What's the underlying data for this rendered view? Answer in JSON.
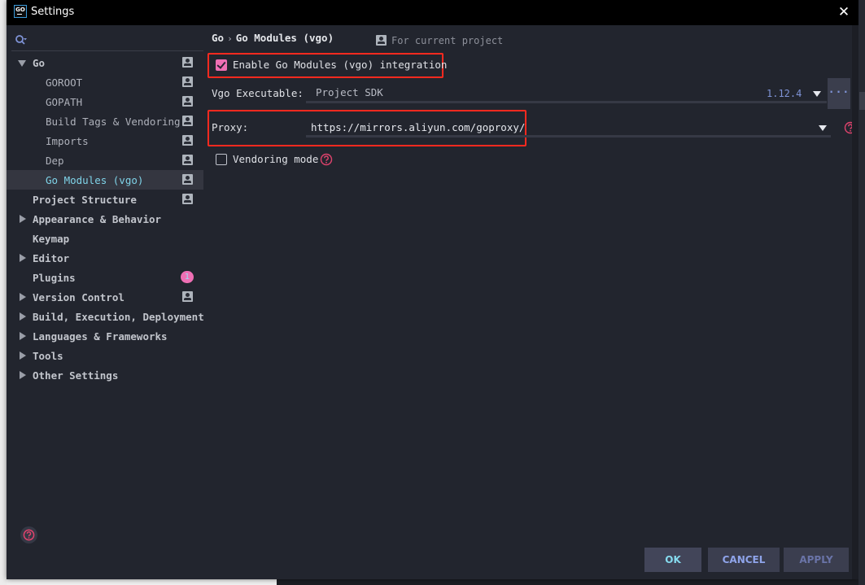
{
  "window": {
    "title": "Settings",
    "app_icon": "GO",
    "close_icon": "close-icon"
  },
  "sidebar": {
    "search": {
      "placeholder": "",
      "value": ""
    },
    "items": [
      {
        "label": "Go",
        "level": 1,
        "expander": "expanded",
        "project_scope": true
      },
      {
        "label": "GOROOT",
        "level": 2,
        "project_scope": true
      },
      {
        "label": "GOPATH",
        "level": 2,
        "project_scope": true
      },
      {
        "label": "Build Tags & Vendoring",
        "level": 2,
        "project_scope": true
      },
      {
        "label": "Imports",
        "level": 2,
        "project_scope": true
      },
      {
        "label": "Dep",
        "level": 2,
        "project_scope": true
      },
      {
        "label": "Go Modules (vgo)",
        "level": 2,
        "project_scope": true,
        "selected": true
      },
      {
        "label": "Project Structure",
        "level": 1,
        "project_scope": true
      },
      {
        "label": "Appearance & Behavior",
        "level": 1,
        "expander": "collapsed"
      },
      {
        "label": "Keymap",
        "level": 1
      },
      {
        "label": "Editor",
        "level": 1,
        "expander": "collapsed"
      },
      {
        "label": "Plugins",
        "level": 1,
        "badge": "1"
      },
      {
        "label": "Version Control",
        "level": 1,
        "expander": "collapsed",
        "project_scope": true
      },
      {
        "label": "Build, Execution, Deployment",
        "level": 1,
        "expander": "collapsed"
      },
      {
        "label": "Languages & Frameworks",
        "level": 1,
        "expander": "collapsed"
      },
      {
        "label": "Tools",
        "level": 1,
        "expander": "collapsed"
      },
      {
        "label": "Other Settings",
        "level": 1,
        "expander": "collapsed"
      }
    ]
  },
  "main": {
    "breadcrumb": {
      "parent": "Go",
      "separator": "›",
      "current": "Go Modules (vgo)"
    },
    "scope_label": "For current project",
    "enable_checkbox": {
      "label": "Enable Go Modules (vgo) integration",
      "checked": true
    },
    "vgo_executable": {
      "label": "Vgo Executable:",
      "value": "Project SDK",
      "version": "1.12.4",
      "browse_label": "..."
    },
    "proxy": {
      "label": "Proxy:",
      "value": "https://mirrors.aliyun.com/goproxy/"
    },
    "vendoring_checkbox": {
      "label": "Vendoring mode",
      "checked": false
    }
  },
  "footer": {
    "ok_label": "OK",
    "cancel_label": "CANCEL",
    "apply_label": "APPLY"
  },
  "colors": {
    "background": "#22252e",
    "accent_pink": "#ef6fb4",
    "selected_text": "#7fd3e8",
    "highlight_box": "#ff2a1f",
    "help_icon": "#e0436d",
    "version_text": "#7f93d6"
  }
}
